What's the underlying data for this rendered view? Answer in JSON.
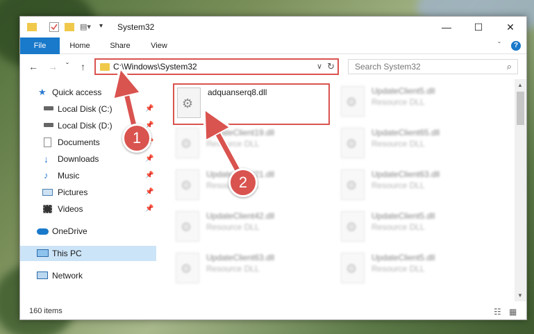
{
  "window": {
    "title": "System32",
    "min_glyph": "—",
    "max_glyph": "☐",
    "close_glyph": "✕"
  },
  "ribbon": {
    "tabs": [
      "File",
      "Home",
      "Share",
      "View"
    ],
    "collapse_glyph": "ˇ",
    "help_glyph": "?"
  },
  "nav": {
    "back_glyph": "←",
    "forward_glyph": "→",
    "recent_glyph": "ˇ",
    "up_glyph": "↑",
    "address": "C:\\Windows\\System32",
    "address_drop_glyph": "∨",
    "refresh_glyph": "↻",
    "search_placeholder": "Search System32",
    "search_glyph": "⌕"
  },
  "sidebar": {
    "items": [
      {
        "label": "Quick access",
        "icon": "star-icon",
        "pinned": false
      },
      {
        "label": "Local Disk (C:)",
        "icon": "drive-icon",
        "pinned": true
      },
      {
        "label": "Local Disk (D:)",
        "icon": "drive-icon",
        "pinned": true
      },
      {
        "label": "Documents",
        "icon": "documents-icon",
        "pinned": true
      },
      {
        "label": "Downloads",
        "icon": "downloads-icon",
        "pinned": true
      },
      {
        "label": "Music",
        "icon": "music-icon",
        "pinned": true
      },
      {
        "label": "Pictures",
        "icon": "pictures-icon",
        "pinned": true
      },
      {
        "label": "Videos",
        "icon": "videos-icon",
        "pinned": true
      },
      {
        "label": "OneDrive",
        "icon": "cloud-icon",
        "pinned": false
      },
      {
        "label": "This PC",
        "icon": "computer-icon",
        "pinned": false,
        "selected": true
      },
      {
        "label": "Network",
        "icon": "network-icon",
        "pinned": false
      }
    ],
    "pin_glyph": "📌"
  },
  "files": {
    "highlighted": {
      "name": "adquanserq8.dll",
      "type": ""
    },
    "items": [
      {
        "name": "UpdateClient5.dll",
        "type": "Resource DLL"
      },
      {
        "name": "UpdateClient19.dll",
        "type": "Resource DLL"
      },
      {
        "name": "UpdateClient65.dll",
        "type": "Resource DLL"
      },
      {
        "name": "UpdateClient21.dll",
        "type": "Resource DLL"
      },
      {
        "name": "UpdateClient63.dll",
        "type": "Resource DLL"
      },
      {
        "name": "UpdateClient42.dll",
        "type": "Resource DLL"
      },
      {
        "name": "UpdateClient5.dll",
        "type": "Resource DLL"
      },
      {
        "name": "UpdateClient63.dll",
        "type": "Resource DLL"
      },
      {
        "name": "UpdateClient5.dll",
        "type": "Resource DLL"
      }
    ]
  },
  "status": {
    "count": "160 items"
  },
  "callouts": [
    "1",
    "2"
  ],
  "colors": {
    "accent": "#1979ca",
    "highlight_red": "#d9534f",
    "selected_bg": "#cce4f7"
  }
}
